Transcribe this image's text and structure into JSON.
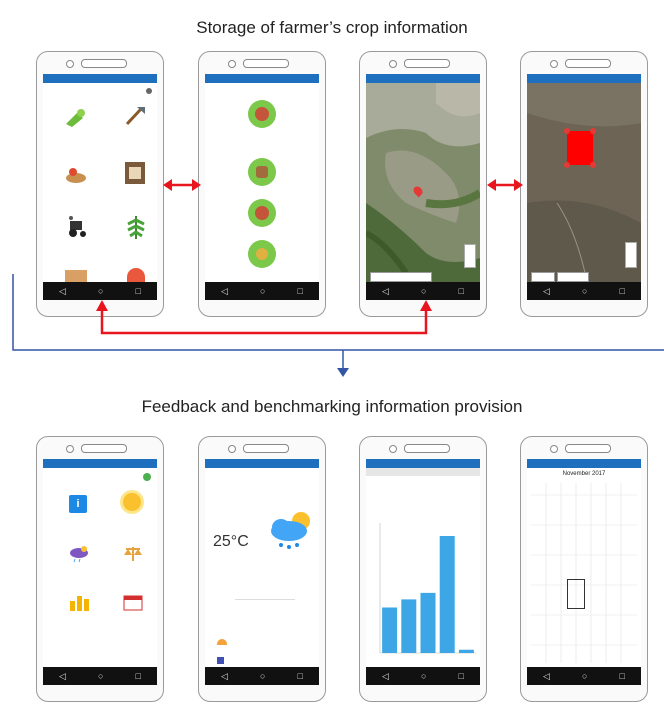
{
  "titles": {
    "top": "Storage of farmer’s crop information",
    "bottom": "Feedback and benchmarking information provision"
  },
  "colors": {
    "status_bar": "#1f6fbf",
    "arrow_red": "#e8141e",
    "connector_blue": "#3355a5",
    "chart_bar": "#3ca6e6",
    "field_red": "#ff0000"
  },
  "weather": {
    "temperature": "25°C"
  },
  "calendar": {
    "month": "November 2017"
  },
  "chart_data": {
    "type": "bar",
    "values": [
      28,
      33,
      37,
      72,
      2
    ],
    "ylim": [
      0,
      80
    ]
  }
}
